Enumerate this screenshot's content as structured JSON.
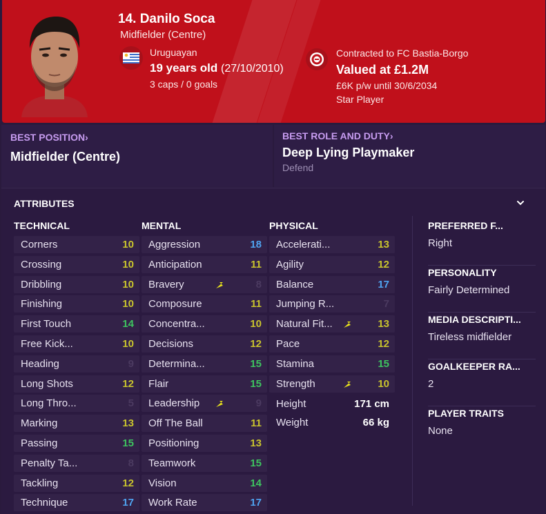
{
  "header": {
    "name": "14. Danilo Soca",
    "position": "Midfielder (Centre)",
    "nationality": "Uruguayan",
    "age": "19 years old",
    "dob": "(27/10/2010)",
    "caps": "3 caps / 0 goals",
    "contract": "Contracted to FC Bastia-Borgo",
    "value": "Valued at £1.2M",
    "wage": "£6K p/w until 30/6/2034",
    "status": "Star Player"
  },
  "best_position": {
    "title": "BEST POSITION",
    "chevron": "›",
    "value": "Midfielder (Centre)"
  },
  "best_role": {
    "title": "BEST ROLE AND DUTY",
    "chevron": "›",
    "value": "Deep Lying Playmaker",
    "duty": "Defend"
  },
  "attributes": {
    "title": "ATTRIBUTES",
    "technical": {
      "title": "TECHNICAL",
      "items": [
        {
          "name": "Corners",
          "value": "10",
          "tone": "yellow"
        },
        {
          "name": "Crossing",
          "value": "10",
          "tone": "yellow"
        },
        {
          "name": "Dribbling",
          "value": "10",
          "tone": "yellow"
        },
        {
          "name": "Finishing",
          "value": "10",
          "tone": "yellow"
        },
        {
          "name": "First Touch",
          "value": "14",
          "tone": "green"
        },
        {
          "name": "Free Kick...",
          "value": "10",
          "tone": "yellow"
        },
        {
          "name": "Heading",
          "value": "9",
          "tone": "dim"
        },
        {
          "name": "Long Shots",
          "value": "12",
          "tone": "yellow"
        },
        {
          "name": "Long Thro...",
          "value": "5",
          "tone": "dim"
        },
        {
          "name": "Marking",
          "value": "13",
          "tone": "yellow"
        },
        {
          "name": "Passing",
          "value": "15",
          "tone": "green"
        },
        {
          "name": "Penalty Ta...",
          "value": "8",
          "tone": "dim"
        },
        {
          "name": "Tackling",
          "value": "12",
          "tone": "yellow"
        },
        {
          "name": "Technique",
          "value": "17",
          "tone": "blue"
        }
      ]
    },
    "mental": {
      "title": "MENTAL",
      "items": [
        {
          "name": "Aggression",
          "value": "18",
          "tone": "blue"
        },
        {
          "name": "Anticipation",
          "value": "11",
          "tone": "yellow"
        },
        {
          "name": "Bravery",
          "value": "8",
          "tone": "dim",
          "arrow": true
        },
        {
          "name": "Composure",
          "value": "11",
          "tone": "yellow"
        },
        {
          "name": "Concentra...",
          "value": "10",
          "tone": "yellow"
        },
        {
          "name": "Decisions",
          "value": "12",
          "tone": "yellow"
        },
        {
          "name": "Determina...",
          "value": "15",
          "tone": "green"
        },
        {
          "name": "Flair",
          "value": "15",
          "tone": "green"
        },
        {
          "name": "Leadership",
          "value": "9",
          "tone": "dim",
          "arrow": true
        },
        {
          "name": "Off The Ball",
          "value": "11",
          "tone": "yellow"
        },
        {
          "name": "Positioning",
          "value": "13",
          "tone": "yellow"
        },
        {
          "name": "Teamwork",
          "value": "15",
          "tone": "green"
        },
        {
          "name": "Vision",
          "value": "14",
          "tone": "green"
        },
        {
          "name": "Work Rate",
          "value": "17",
          "tone": "blue"
        }
      ]
    },
    "physical": {
      "title": "PHYSICAL",
      "items": [
        {
          "name": "Accelerati...",
          "value": "13",
          "tone": "yellow"
        },
        {
          "name": "Agility",
          "value": "12",
          "tone": "yellow"
        },
        {
          "name": "Balance",
          "value": "17",
          "tone": "blue"
        },
        {
          "name": "Jumping R...",
          "value": "7",
          "tone": "dim"
        },
        {
          "name": "Natural Fit...",
          "value": "13",
          "tone": "yellow",
          "arrow": true
        },
        {
          "name": "Pace",
          "value": "12",
          "tone": "yellow"
        },
        {
          "name": "Stamina",
          "value": "15",
          "tone": "green"
        },
        {
          "name": "Strength",
          "value": "10",
          "tone": "yellow",
          "arrow": true
        }
      ],
      "height_label": "Height",
      "height_value": "171 cm",
      "weight_label": "Weight",
      "weight_value": "66 kg"
    }
  },
  "info": [
    {
      "title": "PREFERRED F...",
      "value": "Right"
    },
    {
      "title": "PERSONALITY",
      "value": "Fairly Determined"
    },
    {
      "title": "MEDIA DESCRIPTI...",
      "value": "Tireless midfielder"
    },
    {
      "title": "GOALKEEPER RA...",
      "value": "2"
    },
    {
      "title": "PLAYER TRAITS",
      "value": "None"
    }
  ],
  "colors": {
    "header_red": "#c0101b",
    "panel_purple": "#2e1d45",
    "accent_lilac": "#c79cf0",
    "yellow": "#c9c42d",
    "green": "#3ec45f",
    "blue": "#4fa3f0"
  },
  "icons": {
    "flag": "uruguay-flag-icon",
    "club": "club-crest-icon",
    "chevron": "chevron-down-icon",
    "arrow": "trend-arrow-icon"
  }
}
